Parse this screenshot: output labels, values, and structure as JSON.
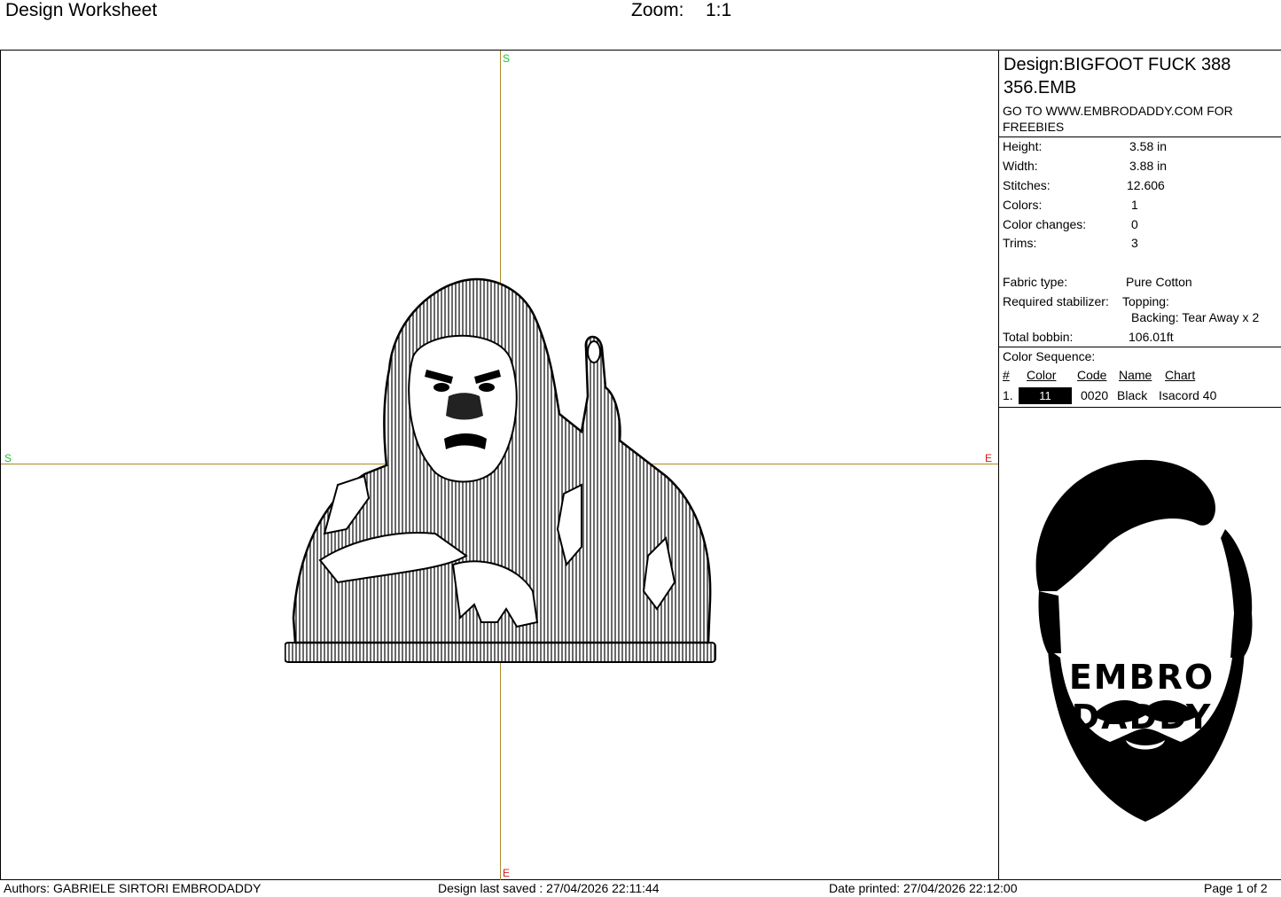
{
  "header": {
    "title": "Design Worksheet",
    "zoom_label": "Zoom:",
    "zoom_value": "1:1"
  },
  "canvas": {
    "marks": {
      "top": "S",
      "bottom": "E",
      "left": "S",
      "right": "E"
    }
  },
  "panel": {
    "design_name": "Design:BIGFOOT FUCK 388 356.EMB",
    "note": "GO TO WWW.EMBRODADDY.COM FOR FREEBIES",
    "specs": [
      {
        "label": "Height:",
        "value": "3.58 in"
      },
      {
        "label": "Width:",
        "value": "3.88 in"
      },
      {
        "label": "Stitches:",
        "value": "12.606"
      },
      {
        "label": "Colors:",
        "value": "1"
      },
      {
        "label": "Color changes:",
        "value": "0"
      },
      {
        "label": "Trims:",
        "value": "3"
      }
    ],
    "fabric_type_label": "Fabric type:",
    "fabric_type_value": "Pure Cotton",
    "stabilizer_label": "Required stabilizer:",
    "stabilizer_topping": "Topping:",
    "stabilizer_backing": "Backing: Tear Away x 2",
    "bobbin_label": "Total bobbin:",
    "bobbin_value": "106.01ft",
    "color_sequence_label": "Color Sequence:",
    "sequence_headers": [
      "#",
      "Color",
      "Code",
      "Name",
      "Chart"
    ],
    "sequence_rows": [
      {
        "num": "1.",
        "color": "11",
        "code": "0020",
        "name": "Black",
        "chart": "Isacord 40",
        "swatch": "#000000"
      }
    ],
    "logo_line1": "EMBRO",
    "logo_line2": "DADDY"
  },
  "footer": {
    "authors": "Authors: GABRIELE SIRTORI EMBRODADDY",
    "saved": "Design last saved : 27/04/2026 22:11:44",
    "printed": "Date printed: 27/04/2026 22:12:00",
    "page": "Page 1 of 2"
  }
}
